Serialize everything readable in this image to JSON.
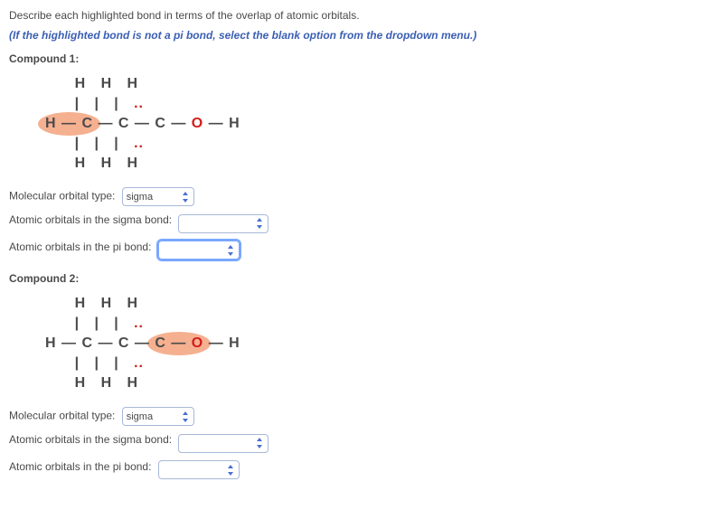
{
  "instruction": "Describe each highlighted bond in terms of the overlap of atomic orbitals.",
  "hint": "(If the highlighted bond is not a pi bond, select the blank option from the dropdown menu.)",
  "compound1": {
    "label": "Compound 1:",
    "q1_label": "Molecular orbital type:",
    "q1_value": "sigma",
    "q2_label": "Atomic orbitals in the sigma bond:",
    "q2_value": "",
    "q3_label": "Atomic orbitals in the pi bond:",
    "q3_value": ""
  },
  "compound2": {
    "label": "Compound 2:",
    "q1_label": "Molecular orbital type:",
    "q1_value": "sigma",
    "q2_label": "Atomic orbitals in the sigma bond:",
    "q2_value": "",
    "q3_label": "Atomic orbitals in the pi bond:",
    "q3_value": ""
  },
  "diagram": {
    "top": "H   H   H",
    "bar": "|   |   |",
    "mid_pre": "",
    "mid_hc": "H — C",
    "mid_rest": " — C — C — ",
    "mid_co": "C — O",
    "o": "O",
    "mid_end": " — H",
    "lone_top": "..",
    "lone_bot": "..",
    "bot": "H   H   H"
  }
}
